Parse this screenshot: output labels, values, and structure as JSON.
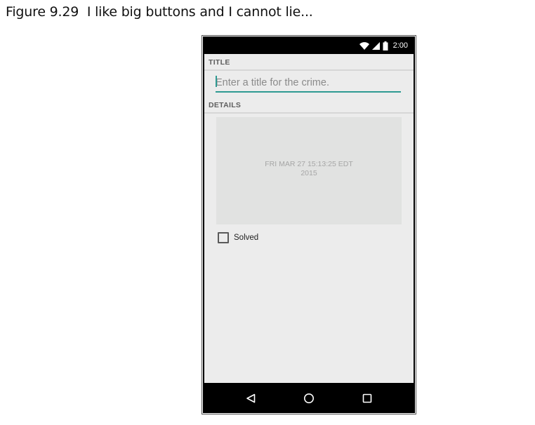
{
  "caption": "Figure 9.29  I like big buttons and I cannot lie...",
  "status_bar": {
    "time": "2:00",
    "icons": [
      "wifi-icon",
      "cell-signal-icon",
      "battery-icon"
    ]
  },
  "form": {
    "title_header": "TITLE",
    "title_placeholder": "Enter a title for the crime.",
    "title_value": "",
    "details_header": "DETAILS",
    "date_button_line1": "FRI MAR 27 15:13:25 EDT",
    "date_button_line2": "2015",
    "solved_label": "Solved",
    "solved_checked": false
  },
  "nav_bar": {
    "icons": [
      "back-icon",
      "home-icon",
      "recents-icon"
    ]
  },
  "colors": {
    "accent": "#2e9a92",
    "screen_background": "#ececec",
    "date_button_background": "#e1e2e1",
    "header_text": "#5e5e5e"
  }
}
